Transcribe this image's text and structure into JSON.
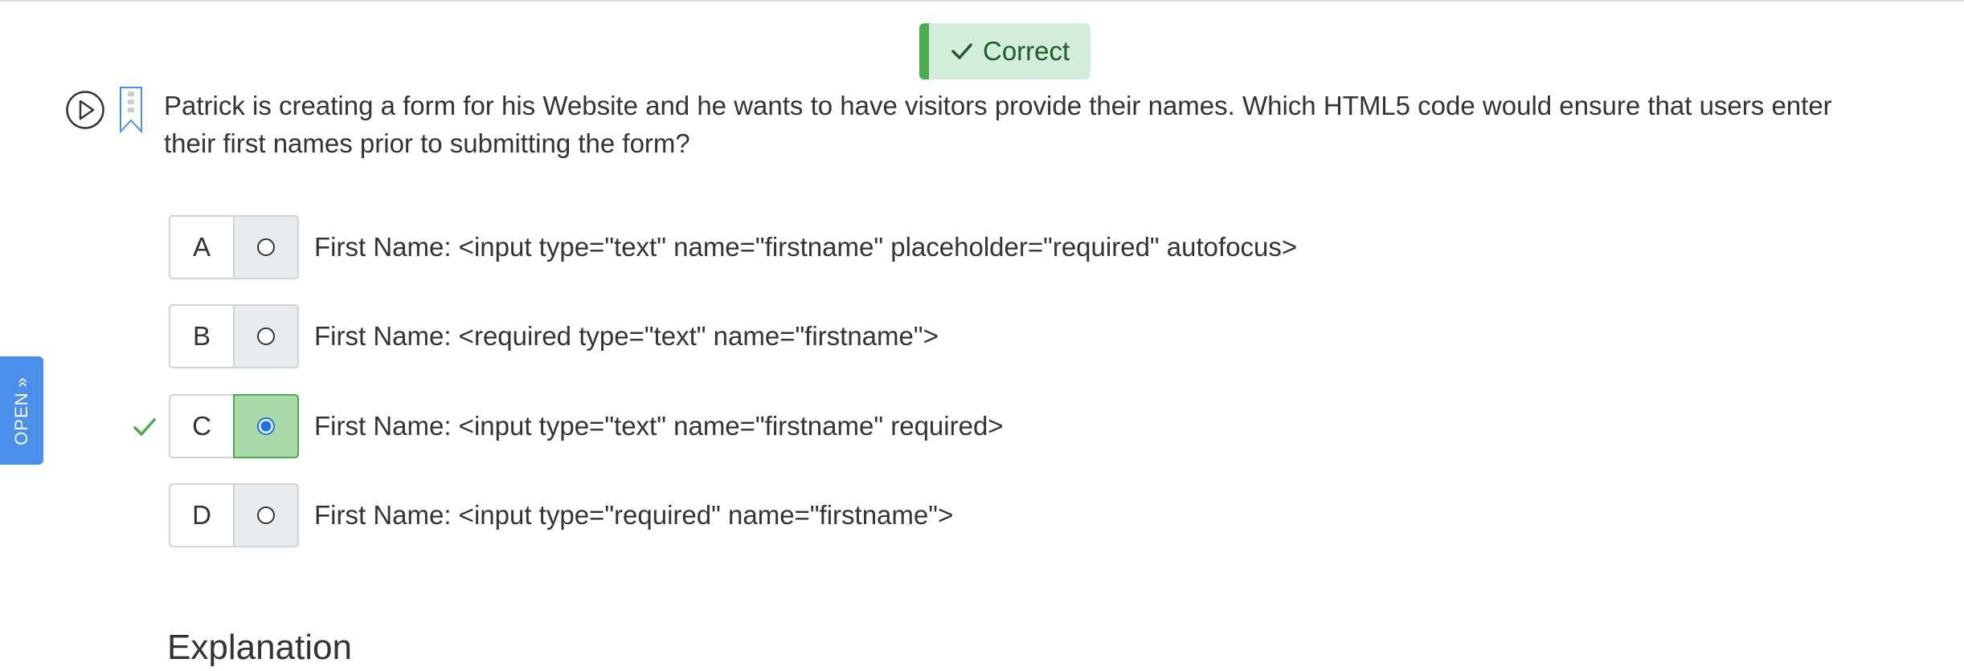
{
  "result": {
    "label": "Correct",
    "icon": "checkmark-icon",
    "background_color": "#d4edda",
    "accent_color": "#4caa4f"
  },
  "question": {
    "text": "Patrick is creating a form for his Website and he wants to have visitors provide their names. Which HTML5 code would ensure that users enter their first names prior to submitting the form?",
    "icons": [
      "play-icon",
      "bookmark-icon"
    ]
  },
  "options": [
    {
      "letter": "A",
      "text": "First Name: <input type=\"text\" name=\"firstname\" placeholder=\"required\" autofocus>",
      "selected": false,
      "correct": false
    },
    {
      "letter": "B",
      "text": "First Name: <required type=\"text\" name=\"firstname\">",
      "selected": false,
      "correct": false
    },
    {
      "letter": "C",
      "text": "First Name: <input type=\"text\" name=\"firstname\" required>",
      "selected": true,
      "correct": true
    },
    {
      "letter": "D",
      "text": "First Name: <input type=\"required\" name=\"firstname\">",
      "selected": false,
      "correct": false
    }
  ],
  "side_tab": {
    "label": "OPEN",
    "icon": "double-chevron-icon",
    "color": "#4a8fea"
  },
  "explanation": {
    "heading": "Explanation"
  }
}
